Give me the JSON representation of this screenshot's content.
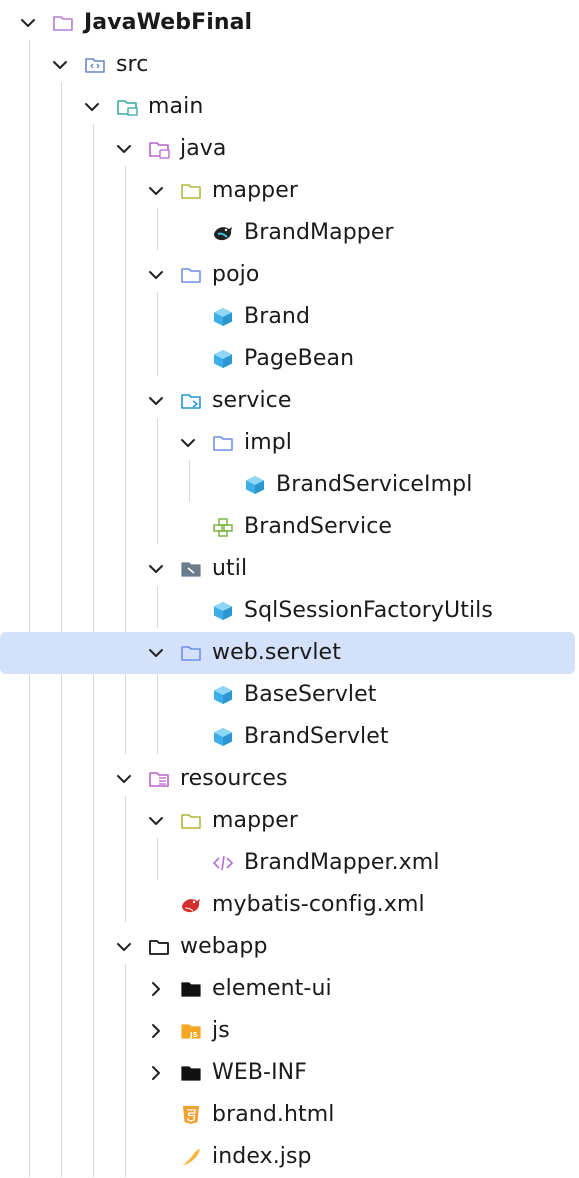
{
  "tree": [
    {
      "label": "JavaWebFinal",
      "icon": "folder-icon",
      "color": "#b97ad6",
      "level": 0,
      "expanded": true,
      "bold": true
    },
    {
      "label": "src",
      "icon": "source-folder-icon",
      "color": "#6b86c9",
      "level": 1,
      "expanded": true
    },
    {
      "label": "main",
      "icon": "module-folder-icon",
      "color": "#3aa8a0",
      "level": 2,
      "expanded": true
    },
    {
      "label": "java",
      "icon": "java-folder-icon",
      "color": "#b563c9",
      "level": 3,
      "expanded": true
    },
    {
      "label": "mapper",
      "icon": "folder-icon",
      "color": "#b2b53a",
      "level": 4,
      "expanded": true
    },
    {
      "label": "BrandMapper",
      "icon": "mybatis-bird-icon",
      "color": "#222222",
      "level": 5
    },
    {
      "label": "pojo",
      "icon": "folder-icon",
      "color": "#6f8fe6",
      "level": 4,
      "expanded": true
    },
    {
      "label": "Brand",
      "icon": "class-cube-icon",
      "color": "#3daee9",
      "level": 5
    },
    {
      "label": "PageBean",
      "icon": "class-cube-icon",
      "color": "#3daee9",
      "level": 5
    },
    {
      "label": "service",
      "icon": "service-folder-icon",
      "color": "#2196d6",
      "level": 4,
      "expanded": true
    },
    {
      "label": "impl",
      "icon": "folder-icon",
      "color": "#6f8fe6",
      "level": 5,
      "expanded": true
    },
    {
      "label": "BrandServiceImpl",
      "icon": "class-cube-icon",
      "color": "#3daee9",
      "level": 6
    },
    {
      "label": "BrandService",
      "icon": "interface-icon",
      "color": "#7cb342",
      "level": 5
    },
    {
      "label": "util",
      "icon": "util-folder-icon",
      "color": "#6b7c8a",
      "level": 4,
      "expanded": true
    },
    {
      "label": "SqlSessionFactoryUtils",
      "icon": "class-cube-icon",
      "color": "#3daee9",
      "level": 5
    },
    {
      "label": "web.servlet",
      "icon": "folder-icon",
      "color": "#6f8fe6",
      "level": 4,
      "expanded": true,
      "selected": true
    },
    {
      "label": "BaseServlet",
      "icon": "class-cube-icon",
      "color": "#3daee9",
      "level": 5
    },
    {
      "label": "BrandServlet",
      "icon": "class-cube-icon",
      "color": "#3daee9",
      "level": 5
    },
    {
      "label": "resources",
      "icon": "resources-folder-icon",
      "color": "#b563c9",
      "level": 3,
      "expanded": true
    },
    {
      "label": "mapper",
      "icon": "folder-icon",
      "color": "#b2b53a",
      "level": 4,
      "expanded": true
    },
    {
      "label": "BrandMapper.xml",
      "icon": "xml-code-icon",
      "color": "#b36fd8",
      "level": 5
    },
    {
      "label": "mybatis-config.xml",
      "icon": "mybatis-red-bird-icon",
      "color": "#d32f2f",
      "level": 4
    },
    {
      "label": "webapp",
      "icon": "folder-outline-icon",
      "color": "#111111",
      "level": 3,
      "expanded": true
    },
    {
      "label": "element-ui",
      "icon": "folder-filled-icon",
      "color": "#111111",
      "level": 4,
      "expanded": false
    },
    {
      "label": "js",
      "icon": "js-folder-icon",
      "color": "#f5a623",
      "level": 4,
      "expanded": false
    },
    {
      "label": "WEB-INF",
      "icon": "folder-filled-icon",
      "color": "#111111",
      "level": 4,
      "expanded": false
    },
    {
      "label": "brand.html",
      "icon": "html5-icon",
      "color": "#f0a030",
      "level": 4
    },
    {
      "label": "index.jsp",
      "icon": "jsp-icon",
      "color": "#f3b23a",
      "level": 4
    }
  ]
}
